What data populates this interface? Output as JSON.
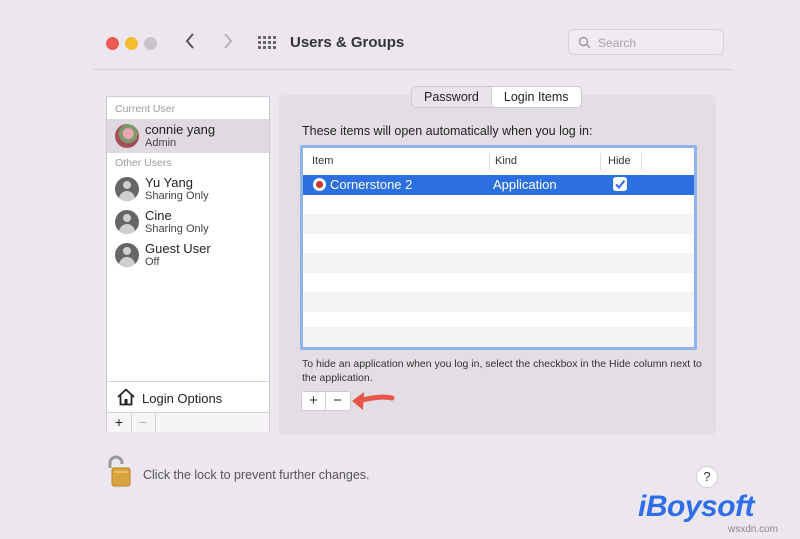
{
  "window": {
    "title": "Users & Groups",
    "search_placeholder": "Search",
    "traffic_lights": {
      "close": "#ee5a52",
      "minimize": "#f5bd2e",
      "zoom": "#c8c4ca"
    }
  },
  "sidebar": {
    "current_header": "Current User",
    "current_user": {
      "name": "connie yang",
      "role": "Admin"
    },
    "other_header": "Other Users",
    "other_users": [
      {
        "name": "Yu Yang",
        "role": "Sharing Only"
      },
      {
        "name": "Cine",
        "role": "Sharing Only"
      },
      {
        "name": "Guest User",
        "role": "Off"
      }
    ],
    "login_options": "Login Options",
    "add_label": "+",
    "remove_label": "−"
  },
  "tabs": {
    "items": [
      {
        "label": "Password",
        "active": false
      },
      {
        "label": "Login Items",
        "active": true
      }
    ]
  },
  "login_items": {
    "intro": "These items will open automatically when you log in:",
    "columns": {
      "item": "Item",
      "kind": "Kind",
      "hide": "Hide"
    },
    "rows": [
      {
        "item": "Cornerstone 2",
        "kind": "Application",
        "hide": true,
        "selected": true
      }
    ],
    "hint": "To hide an application when you log in, select the checkbox in the Hide column next to the application.",
    "add_label": "+",
    "remove_label": "−"
  },
  "footer": {
    "lock_text": "Click the lock to prevent further changes.",
    "help_label": "?"
  },
  "branding": {
    "logo": "iBoysoft",
    "site": "wsxdn.com"
  },
  "colors": {
    "accent": "#2c6fe0",
    "focus_ring": "#8fb3ea",
    "annotation_arrow": "#e8564a"
  }
}
